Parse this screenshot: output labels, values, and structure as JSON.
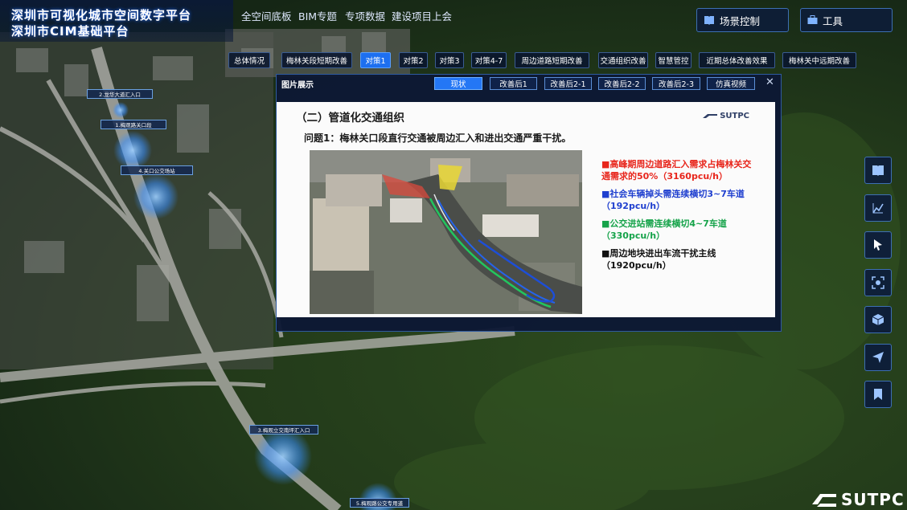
{
  "header": {
    "title_line1": "深圳市可视化城市空间数字平台",
    "title_line2": "深圳市CIM基础平台",
    "nav": [
      "全空间底板",
      "BIM专题",
      "专项数据",
      "建设项目上会"
    ],
    "scene_control_label": "场景控制",
    "tools_label": "工具"
  },
  "tabs": [
    {
      "label": "总体情况",
      "active": false
    },
    {
      "label": "梅林关段短期改善",
      "active": false
    },
    {
      "label": "对策1",
      "active": true
    },
    {
      "label": "对策2",
      "active": false
    },
    {
      "label": "对策3",
      "active": false
    },
    {
      "label": "对策4-7",
      "active": false
    },
    {
      "label": "周边道路短期改善",
      "active": false
    },
    {
      "label": "交通组织改善",
      "active": false
    },
    {
      "label": "智慧管控",
      "active": false
    },
    {
      "label": "近期总体改善效果",
      "active": false
    },
    {
      "label": "梅林关中远期改善",
      "active": false
    }
  ],
  "dialog": {
    "title": "图片展示",
    "buttons": [
      {
        "label": "现状",
        "active": true
      },
      {
        "label": "改善后1",
        "active": false
      },
      {
        "label": "改善后2-1",
        "active": false
      },
      {
        "label": "改善后2-2",
        "active": false
      },
      {
        "label": "改善后2-3",
        "active": false
      },
      {
        "label": "仿真视频",
        "active": false
      }
    ],
    "close_glyph": "✕",
    "slide": {
      "heading": "（二）管道化交通组织",
      "question": "问题1：梅林关口段直行交通被周边汇入和进出交通严重干扰。",
      "logo_text": "SUTPC",
      "bullets": [
        {
          "text": "■高峰期周边道路汇入需求占梅林关交通需求的50%（3160pcu/h）",
          "color": "#e8261c"
        },
        {
          "text": "■社会车辆掉头需连续横切3~7车道（192pcu/h）",
          "color": "#1f3fcf"
        },
        {
          "text": "■公交进站需连续横切4~7车道（330pcu/h）",
          "color": "#16a34a"
        },
        {
          "text": "■周边地块进出车流干扰主线（1920pcu/h）",
          "color": "#111111"
        }
      ]
    }
  },
  "map_labels": [
    "2.龙华大道汇入口",
    "1.梅观路关口段",
    "4.关口公交场站",
    "3.梅观立交南坪汇入口",
    "5.梅观路公交专用道"
  ],
  "right_tools": [
    "layers-icon",
    "chart-icon",
    "cursor-icon",
    "focus-icon",
    "cube-icon",
    "send-icon",
    "bookmark-icon"
  ],
  "brand": "SUTPC"
}
